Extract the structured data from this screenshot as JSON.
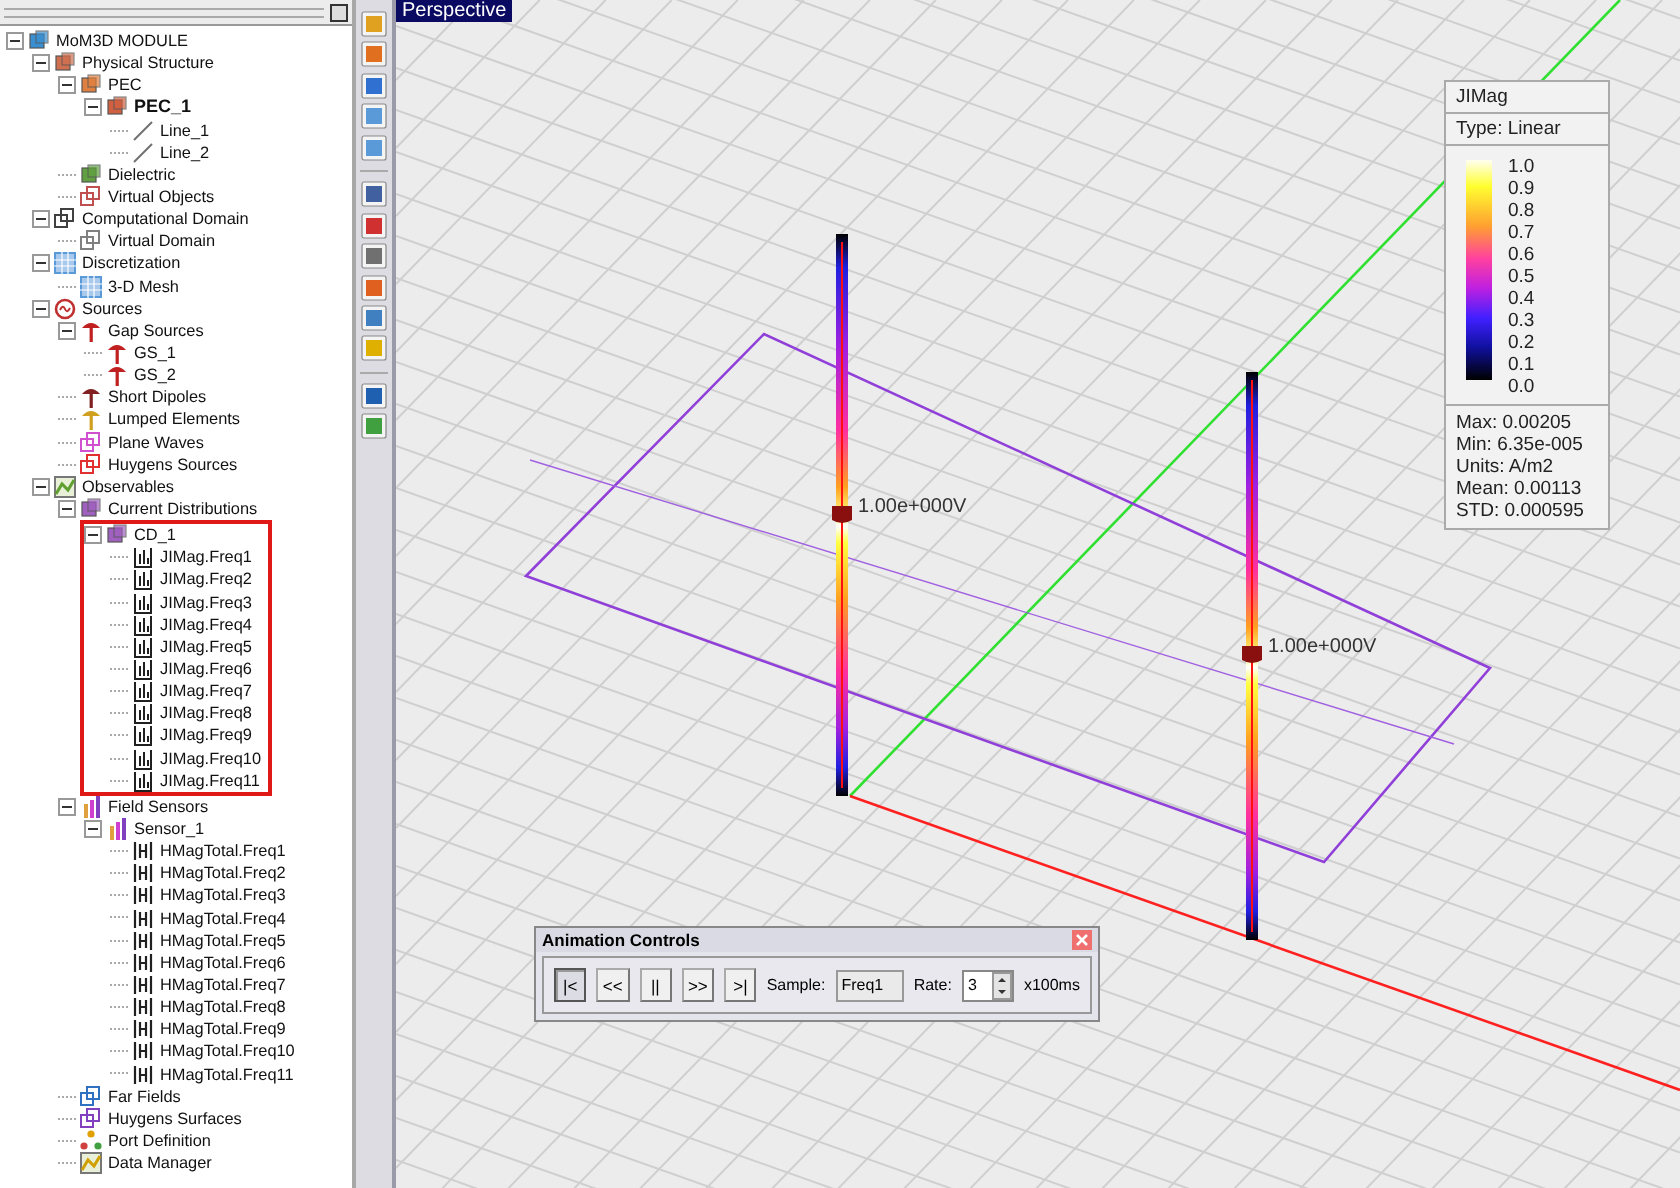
{
  "tree": [
    {
      "label": "MoM3D MODULE",
      "kind": "module",
      "bold": false,
      "highlighted": false,
      "expanded": true,
      "children": [
        {
          "label": "Physical Structure",
          "kind": "structure",
          "bold": false,
          "highlighted": false,
          "expanded": true,
          "children": [
            {
              "label": "PEC",
              "kind": "pec",
              "bold": false,
              "highlighted": false,
              "expanded": true,
              "children": [
                {
                  "label": "PEC_1",
                  "kind": "pecobj",
                  "bold": true,
                  "highlighted": false,
                  "expanded": true,
                  "children": [
                    {
                      "label": "Line_1",
                      "kind": "wire",
                      "bold": false,
                      "highlighted": false
                    },
                    {
                      "label": "Line_2",
                      "kind": "wire",
                      "bold": false,
                      "highlighted": false
                    }
                  ]
                }
              ]
            },
            {
              "label": "Dielectric",
              "kind": "dielectric",
              "bold": false,
              "highlighted": false
            },
            {
              "label": "Virtual Objects",
              "kind": "virtualobj",
              "bold": false,
              "highlighted": false
            }
          ]
        },
        {
          "label": "Computational Domain",
          "kind": "domain",
          "bold": false,
          "highlighted": false,
          "expanded": true,
          "children": [
            {
              "label": "Virtual Domain",
              "kind": "virtualdomain",
              "bold": false,
              "highlighted": false
            }
          ]
        },
        {
          "label": "Discretization",
          "kind": "mesh",
          "bold": false,
          "highlighted": false,
          "expanded": true,
          "children": [
            {
              "label": "3-D Mesh",
              "kind": "mesh",
              "bold": false,
              "highlighted": false
            }
          ]
        },
        {
          "label": "Sources",
          "kind": "sources",
          "bold": false,
          "highlighted": false,
          "expanded": true,
          "children": [
            {
              "label": "Gap Sources",
              "kind": "gap",
              "bold": false,
              "highlighted": false,
              "expanded": true,
              "children": [
                {
                  "label": "GS_1",
                  "kind": "gap",
                  "bold": false,
                  "highlighted": false
                },
                {
                  "label": "GS_2",
                  "kind": "gap",
                  "bold": false,
                  "highlighted": false
                }
              ]
            },
            {
              "label": "Short Dipoles",
              "kind": "dipole",
              "bold": false,
              "highlighted": false
            },
            {
              "label": "Lumped Elements",
              "kind": "lumped",
              "bold": false,
              "highlighted": false
            },
            {
              "label": "Plane Waves",
              "kind": "plane",
              "bold": false,
              "highlighted": false
            },
            {
              "label": "Huygens Sources",
              "kind": "huygens",
              "bold": false,
              "highlighted": false
            }
          ]
        },
        {
          "label": "Observables",
          "kind": "observables",
          "bold": false,
          "highlighted": false,
          "expanded": true,
          "children": [
            {
              "label": "Current Distributions",
              "kind": "current",
              "bold": false,
              "highlighted": false,
              "expanded": true,
              "children": [
                {
                  "label": "CD_1",
                  "kind": "current",
                  "bold": false,
                  "highlighted": true,
                  "expanded": true,
                  "children": [
                    {
                      "label": "JIMag.Freq1",
                      "kind": "plot",
                      "bold": false,
                      "highlighted": false
                    },
                    {
                      "label": "JIMag.Freq2",
                      "kind": "plot",
                      "bold": false,
                      "highlighted": false
                    },
                    {
                      "label": "JIMag.Freq3",
                      "kind": "plot",
                      "bold": false,
                      "highlighted": false
                    },
                    {
                      "label": "JIMag.Freq4",
                      "kind": "plot",
                      "bold": false,
                      "highlighted": false
                    },
                    {
                      "label": "JIMag.Freq5",
                      "kind": "plot",
                      "bold": false,
                      "highlighted": false
                    },
                    {
                      "label": "JIMag.Freq6",
                      "kind": "plot",
                      "bold": false,
                      "highlighted": false
                    },
                    {
                      "label": "JIMag.Freq7",
                      "kind": "plot",
                      "bold": false,
                      "highlighted": false
                    },
                    {
                      "label": "JIMag.Freq8",
                      "kind": "plot",
                      "bold": false,
                      "highlighted": false
                    },
                    {
                      "label": "JIMag.Freq9",
                      "kind": "plot",
                      "bold": false,
                      "highlighted": false
                    },
                    {
                      "label": "JIMag.Freq10",
                      "kind": "plot",
                      "bold": false,
                      "highlighted": false
                    },
                    {
                      "label": "JIMag.Freq11",
                      "kind": "plot",
                      "bold": false,
                      "highlighted": false
                    }
                  ]
                }
              ]
            },
            {
              "label": "Field Sensors",
              "kind": "sensor",
              "bold": false,
              "highlighted": false,
              "expanded": true,
              "children": [
                {
                  "label": "Sensor_1",
                  "kind": "sensor",
                  "bold": false,
                  "highlighted": false,
                  "expanded": true,
                  "children": [
                    {
                      "label": "HMagTotal.Freq1",
                      "kind": "hplot",
                      "bold": false,
                      "highlighted": false
                    },
                    {
                      "label": "HMagTotal.Freq2",
                      "kind": "hplot",
                      "bold": false,
                      "highlighted": false
                    },
                    {
                      "label": "HMagTotal.Freq3",
                      "kind": "hplot",
                      "bold": false,
                      "highlighted": false
                    },
                    {
                      "label": "HMagTotal.Freq4",
                      "kind": "hplot",
                      "bold": false,
                      "highlighted": false
                    },
                    {
                      "label": "HMagTotal.Freq5",
                      "kind": "hplot",
                      "bold": false,
                      "highlighted": false
                    },
                    {
                      "label": "HMagTotal.Freq6",
                      "kind": "hplot",
                      "bold": false,
                      "highlighted": false
                    },
                    {
                      "label": "HMagTotal.Freq7",
                      "kind": "hplot",
                      "bold": false,
                      "highlighted": false
                    },
                    {
                      "label": "HMagTotal.Freq8",
                      "kind": "hplot",
                      "bold": false,
                      "highlighted": false
                    },
                    {
                      "label": "HMagTotal.Freq9",
                      "kind": "hplot",
                      "bold": false,
                      "highlighted": false
                    },
                    {
                      "label": "HMagTotal.Freq10",
                      "kind": "hplot",
                      "bold": false,
                      "highlighted": false
                    },
                    {
                      "label": "HMagTotal.Freq11",
                      "kind": "hplot",
                      "bold": false,
                      "highlighted": false
                    }
                  ]
                }
              ]
            },
            {
              "label": "Far Fields",
              "kind": "farfield",
              "bold": false,
              "highlighted": false
            },
            {
              "label": "Huygens Surfaces",
              "kind": "huygensurf",
              "bold": false,
              "highlighted": false
            },
            {
              "label": "Port Definition",
              "kind": "port",
              "bold": false,
              "highlighted": false
            },
            {
              "label": "Data Manager",
              "kind": "data",
              "bold": false,
              "highlighted": false
            }
          ]
        }
      ]
    }
  ],
  "viewport": {
    "title": "Perspective",
    "sources": [
      {
        "label": "1.00e+000V"
      },
      {
        "label": "1.00e+000V"
      }
    ],
    "legend": {
      "title": "JIMag",
      "type": "Type: Linear",
      "ticks": [
        "1.0",
        "0.9",
        "0.8",
        "0.7",
        "0.6",
        "0.5",
        "0.4",
        "0.3",
        "0.2",
        "0.1",
        "0.0"
      ],
      "stats": [
        "Max: 0.00205",
        "Min: 6.35e-005",
        "Units: A/m2",
        "Mean: 0.00113",
        "STD: 0.000595"
      ]
    }
  },
  "animation": {
    "title": "Animation Controls",
    "buttons": [
      {
        "label": "|<",
        "pressed": true
      },
      {
        "label": "<<",
        "pressed": false
      },
      {
        "label": "||",
        "pressed": false
      },
      {
        "label": ">>",
        "pressed": false
      },
      {
        "label": ">|",
        "pressed": false
      }
    ],
    "sample_label": "Sample:",
    "sample_value": "Freq1",
    "rate_label": "Rate:",
    "rate_value": "3",
    "rate_unit": "x100ms"
  }
}
